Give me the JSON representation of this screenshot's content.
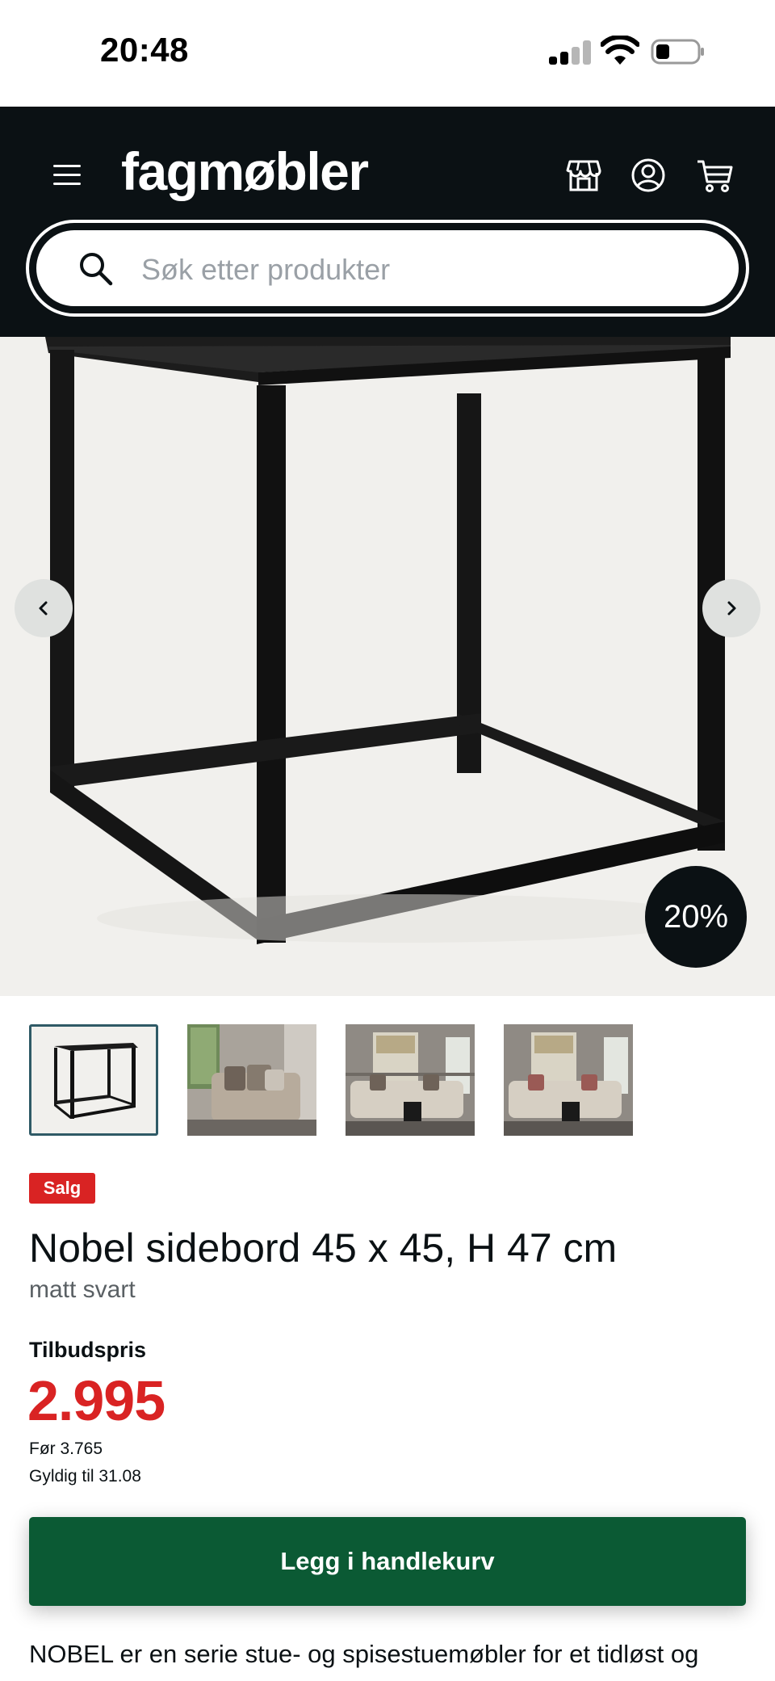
{
  "status_bar": {
    "time": "20:48"
  },
  "header": {
    "logo": "fagmøbler",
    "search": {
      "placeholder": "Søk etter produkter",
      "value": ""
    }
  },
  "product": {
    "discount_badge": "20%",
    "sale_badge": "Salg",
    "title": "Nobel sidebord 45 x 45, H 47 cm",
    "variant": "matt svart",
    "price_label": "Tilbudspris",
    "price": "2.995",
    "price_before": "Før 3.765",
    "valid_until": "Gyldig til 31.08",
    "add_to_cart": "Legg i handlekurv",
    "description": "NOBEL er en serie stue- og spisestuemøbler for et tidløst og"
  },
  "icons": {
    "menu": "menu-icon",
    "store": "store-icon",
    "account": "user-icon",
    "cart": "cart-icon",
    "search": "search-icon",
    "prev": "chevron-left-icon",
    "next": "chevron-right-icon"
  },
  "colors": {
    "header_bg": "#0b1114",
    "sale_red": "#d92323",
    "cart_green": "#0b5a34",
    "image_bg": "#f1f0ed"
  }
}
